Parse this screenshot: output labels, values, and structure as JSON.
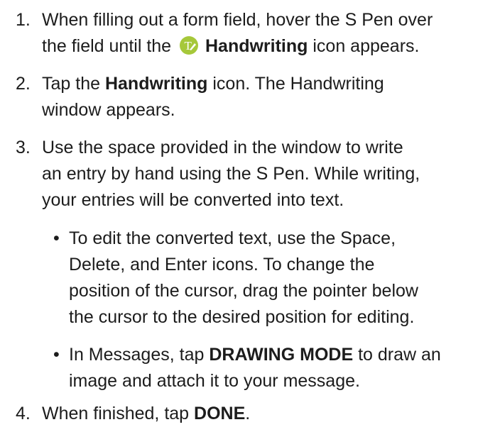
{
  "steps": [
    {
      "number": "1.",
      "line1_pre": "When filling out a form field, hover the S Pen over",
      "line2_pre": "the field until the",
      "icon": "handwriting-icon",
      "bold": "Handwriting",
      "line2_post": "icon appears."
    },
    {
      "number": "2.",
      "pre": "Tap the",
      "bold": "Handwriting",
      "post": "icon. The Handwriting",
      "line2": "window appears."
    },
    {
      "number": "3.",
      "line1": "Use the space provided in the window to write",
      "line2": "an entry by hand using the S Pen. While writing,",
      "line3": "your entries will be converted into text."
    },
    {
      "number": "4.",
      "pre": "When finished, tap",
      "bold": "DONE",
      "post": "."
    }
  ],
  "bullets": [
    {
      "symbol": "•",
      "line1": "To edit the converted text, use the Space,",
      "line2": "Delete, and Enter icons. To change the",
      "line3": "position of the cursor, drag the pointer below",
      "line4": "the cursor to the desired position for editing."
    },
    {
      "symbol": "•",
      "pre": "In Messages, tap",
      "bold": "DRAWING MODE",
      "post": "to draw an",
      "line2": "image and attach it to your message."
    }
  ],
  "colors": {
    "text": "#1c1c1c",
    "icon_fill": "#a6c83a",
    "icon_glyph": "#ffffff"
  }
}
